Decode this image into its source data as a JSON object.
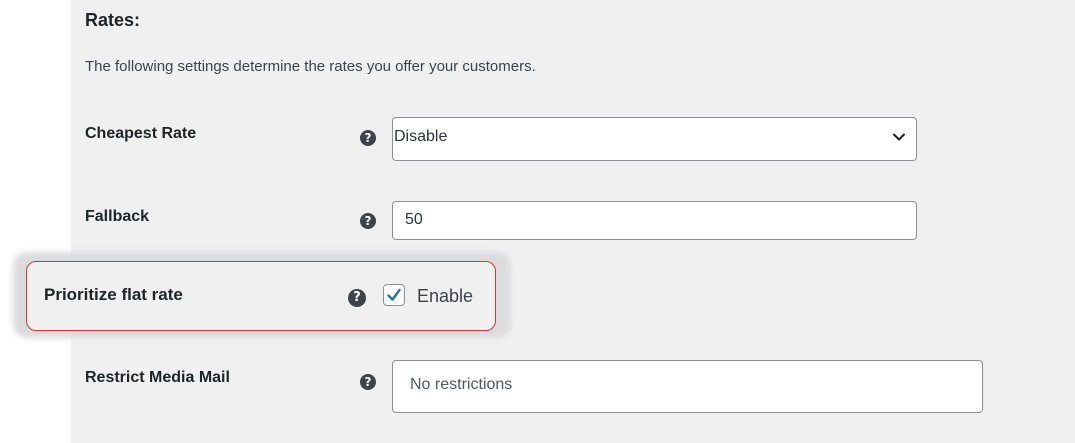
{
  "section": {
    "title": "Rates:",
    "description": "The following settings determine the rates you offer your customers."
  },
  "rows": {
    "cheapest_rate": {
      "label": "Cheapest Rate",
      "help_icon": "question-circle-icon",
      "value": "Disable"
    },
    "fallback": {
      "label": "Fallback",
      "help_icon": "question-circle-icon",
      "value": "50"
    },
    "prioritize_flat_rate": {
      "label": "Prioritize flat rate",
      "help_icon": "question-circle-icon",
      "checkbox_label": "Enable",
      "checked": true
    },
    "restrict_media_mail": {
      "label": "Restrict Media Mail",
      "help_icon": "question-circle-icon",
      "value": "No restrictions"
    }
  },
  "help_glyph": "?",
  "colors": {
    "panel_bg": "#f0f0f1",
    "highlight_border": "#d63638",
    "checkmark": "#2271b1",
    "field_border": "#8c8f94"
  }
}
